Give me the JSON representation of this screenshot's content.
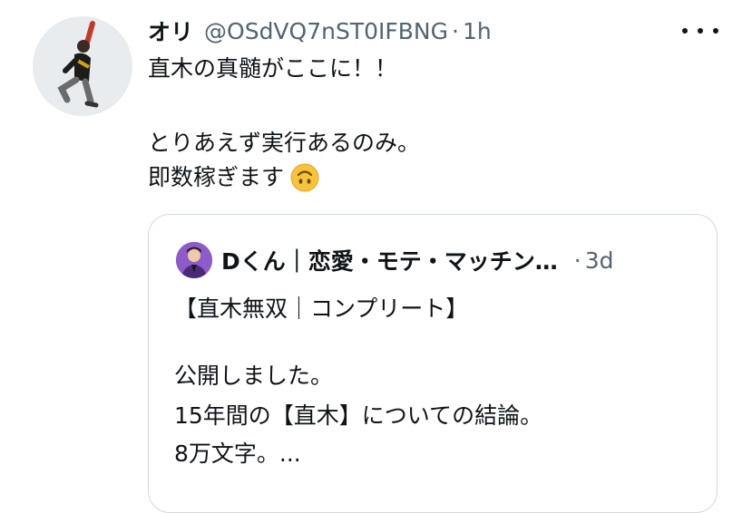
{
  "tweet": {
    "display_name": "オリ",
    "handle": "@OSdVQ7nST0IFBNG",
    "separator": "·",
    "time": "1h",
    "lines": [
      "直木の真髄がここに！！",
      "とりあえず実行あるのみ。",
      "即数稼ぎます"
    ],
    "emoji": "upside-down-face-emoji"
  },
  "quote": {
    "display_name": "Dくん｜恋愛・モテ・マッチン…",
    "separator": "·",
    "time": "3d",
    "lines": [
      "【直木無双｜コンプリート】",
      "公開しました。",
      "15年間の【直木】についての結論。",
      "8万文字。..."
    ]
  },
  "colors": {
    "text": "#0f1419",
    "secondary": "#536471",
    "border": "#cfd9de",
    "emoji": "#f7c23c"
  }
}
